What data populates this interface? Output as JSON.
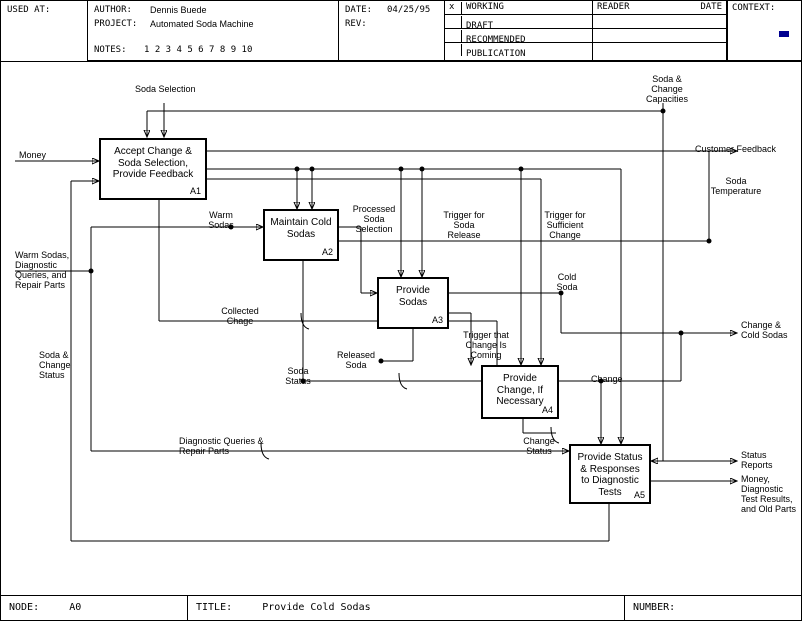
{
  "header": {
    "usedAtLabel": "USED AT:",
    "authorLabel": "AUTHOR:",
    "author": "Dennis Buede",
    "projectLabel": "PROJECT:",
    "project": "Automated Soda Machine",
    "dateLabel": "DATE:",
    "date": "04/25/95",
    "revLabel": "REV:",
    "notesLabel": "NOTES:",
    "notes": "1  2  3  4  5  6  7  8  9  10",
    "statusX": "x",
    "status": {
      "working": "WORKING",
      "draft": "DRAFT",
      "recommended": "RECOMMENDED",
      "publication": "PUBLICATION"
    },
    "readerLabel": "READER",
    "dateCol": "DATE",
    "contextLabel": "CONTEXT:"
  },
  "footer": {
    "nodeLabel": "NODE:",
    "node": "A0",
    "titleLabel": "TITLE:",
    "title": "Provide Cold Sodas",
    "numberLabel": "NUMBER:"
  },
  "functions": {
    "a1": {
      "text": "Accept Change & Soda Selection, Provide Feedback",
      "tag": "A1"
    },
    "a2": {
      "text": "Maintain Cold Sodas",
      "tag": "A2"
    },
    "a3": {
      "text": "Provide Sodas",
      "tag": "A3"
    },
    "a4": {
      "text": "Provide Change, If Necessary",
      "tag": "A4"
    },
    "a5": {
      "text": "Provide Status & Responses to Diagnostic Tests",
      "tag": "A5"
    }
  },
  "labels": {
    "sodaSelection": "Soda Selection",
    "money": "Money",
    "warmSodas": "Warm Sodas",
    "warmIn": "Warm Sodas, Diagnostic Queries, and Repair Parts",
    "scStatus": "Soda & Change Status",
    "collectedChage": "Collected Chage",
    "sodaStatus": "Soda Status",
    "releasedSoda": "Released Soda",
    "processedSel": "Processed Soda Selection",
    "trigRelease": "Trigger for Soda Release",
    "trigSuffChange": "Trigger for Sufficient Change",
    "coldSoda": "Cold Soda",
    "trigChangeComing": "Trigger that Change Is Coming",
    "change": "Change",
    "changeStatus": "Change Status",
    "scCap": "Soda & Change Capacities",
    "sodaTemp": "Soda Temperature",
    "custFb": "Customer Feedback",
    "changeCold": "Change & Cold Sodas",
    "statusReports": "Status Reports",
    "moneyOut": "Money, Diagnostic Test Results, and Old Parts",
    "diagRepair": "Diagnostic Queries & Repair Parts"
  }
}
